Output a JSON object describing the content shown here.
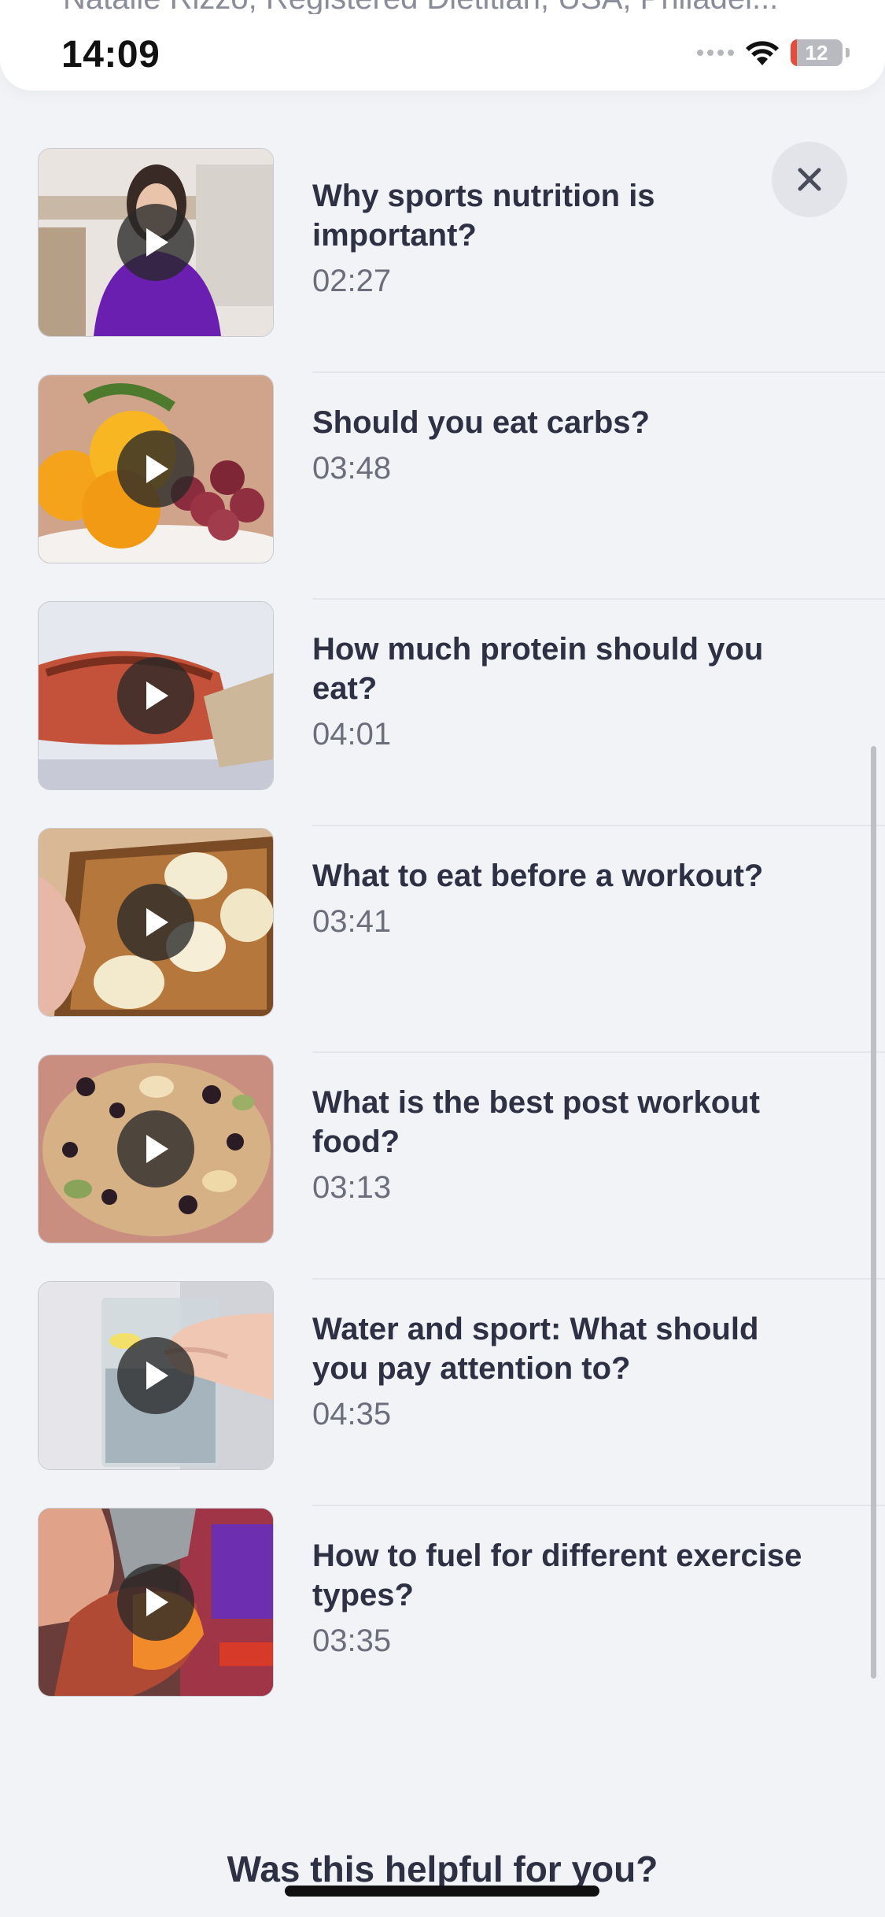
{
  "status_bar": {
    "time": "14:09",
    "battery": "12",
    "battery_fraction": 0.12,
    "peek_text": "Natalie Rizzo, Registered Dietitian, USA, Philadel..."
  },
  "icons": {
    "close": "close-icon",
    "play": "play-icon",
    "wifi": "wifi-icon",
    "signal": "signal-icon",
    "battery": "battery-icon"
  },
  "colors": {
    "background": "#f2f3f7",
    "title": "#2e3044",
    "duration": "#6c6e7c",
    "battery_low": "#e64b3c"
  },
  "videos": [
    {
      "title": "Why sports nutrition is important?",
      "duration": "02:27"
    },
    {
      "title": "Should you eat carbs?",
      "duration": "03:48"
    },
    {
      "title": "How much protein should you eat?",
      "duration": "04:01"
    },
    {
      "title": "What to eat before a workout?",
      "duration": "03:41"
    },
    {
      "title": "What is the best post workout food?",
      "duration": "03:13"
    },
    {
      "title": "Water and sport: What should you pay attention to?",
      "duration": "04:35"
    },
    {
      "title": "How to fuel for different exercise types?",
      "duration": "03:35"
    }
  ],
  "footer": {
    "question": "Was this helpful for you?"
  }
}
